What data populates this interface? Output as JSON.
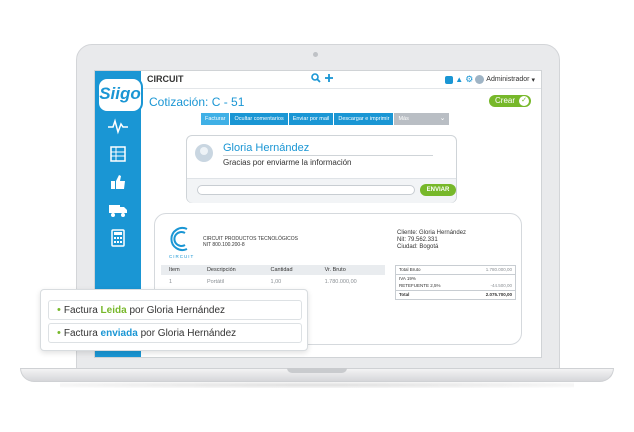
{
  "app": {
    "logo": "Siigo",
    "company": "CIRCUIT",
    "user": "Administrador"
  },
  "icons": [
    "search-icon",
    "add-icon",
    "calendar-icon",
    "bell-icon",
    "gear-icon",
    "user-icon",
    "chart-icon",
    "ledger-icon",
    "thumbs-up-icon",
    "truck-icon",
    "calculator-icon"
  ],
  "colors": {
    "primary": "#1a96d4",
    "accent_green": "#77b82a"
  },
  "page": {
    "title": "Cotización: C - 51",
    "create_label": "Crear"
  },
  "tabs": [
    {
      "label": "Facturar"
    },
    {
      "label": "Ocultar comentarios"
    },
    {
      "label": "Enviar por mail"
    },
    {
      "label": "Descargar e imprimir"
    },
    {
      "label": "Más"
    }
  ],
  "comment": {
    "author": "Gloria Hernández",
    "message": "Gracias por enviarme la información",
    "send_label": "ENVIAR"
  },
  "document": {
    "logo_text": "CIRCUIT",
    "company_name": "CIRCUIT PRODUCTOS TECNOLÓGICOS",
    "company_nit": "NIT 800.100.200-8",
    "client_line": "Cliente: Gloria Hernández",
    "client_nit": "Nit: 79.562.331",
    "client_city": "Ciudad: Bogotá",
    "headers": [
      "Item",
      "Descripción",
      "Cantidad",
      "Vr. Bruto"
    ],
    "rows": [
      [
        "1",
        "Portátil",
        "1,00",
        "1.780.000,00"
      ]
    ],
    "totals": [
      {
        "label": "Total Bruto",
        "value": "1.780.000,00"
      },
      {
        "label": "IVA 19%",
        "value": ""
      },
      {
        "label": "RETEFUENTE 2,5%",
        "value": "-44.500,00"
      },
      {
        "label": "Total",
        "value": "2.075.700,00"
      }
    ]
  },
  "notifications": [
    {
      "prefix": "Factura ",
      "highlight": "Leida",
      "suffix": " por Gloria Hernández"
    },
    {
      "prefix": "Factura ",
      "highlight": "enviada",
      "suffix": " por Gloria Hernández"
    }
  ]
}
